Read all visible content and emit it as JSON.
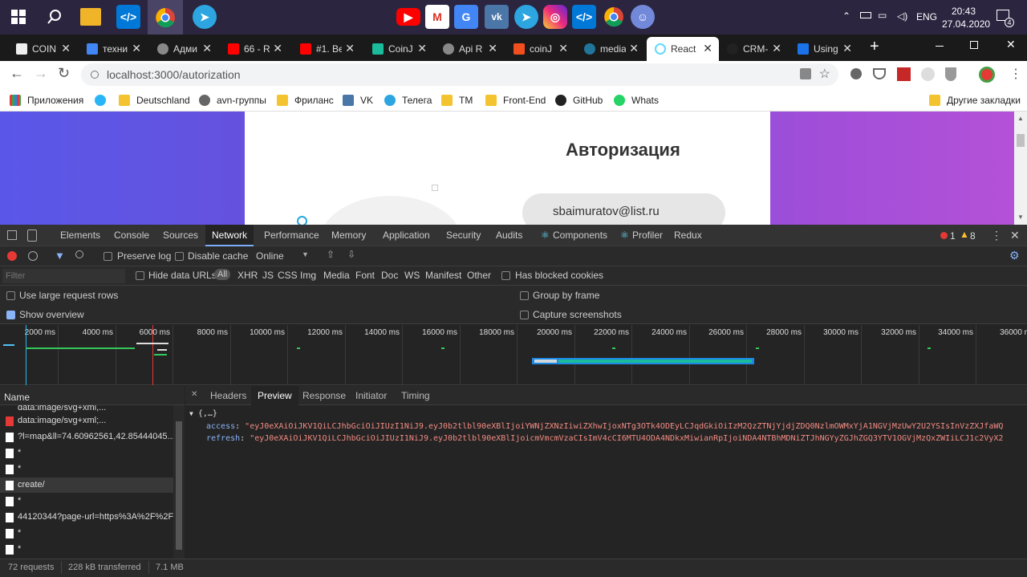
{
  "taskbar": {
    "time": "20:43",
    "date": "27.04.2020",
    "lang": "ENG",
    "notif_count": "4"
  },
  "tabs": [
    {
      "label": "COIN"
    },
    {
      "label": "техни"
    },
    {
      "label": "Адми"
    },
    {
      "label": "66 - R"
    },
    {
      "label": "#1. Be"
    },
    {
      "label": "CoinJ"
    },
    {
      "label": "Api R"
    },
    {
      "label": "coinJ"
    },
    {
      "label": "media"
    },
    {
      "label": "React"
    },
    {
      "label": "CRM-"
    },
    {
      "label": "Using"
    }
  ],
  "address": {
    "url": "localhost:3000/autorization"
  },
  "bookmarks": [
    {
      "label": "Приложения"
    },
    {
      "label": "Deutschland"
    },
    {
      "label": "avn-группы"
    },
    {
      "label": "Фриланс"
    },
    {
      "label": "VK"
    },
    {
      "label": "Телега"
    },
    {
      "label": "TM"
    },
    {
      "label": "Front-End"
    },
    {
      "label": "GitHub"
    },
    {
      "label": "Whats"
    }
  ],
  "other_bookmarks": "Другие закладки",
  "page": {
    "title": "Авторизация",
    "email": "sbaimuratov@list.ru"
  },
  "devtools": {
    "tabs": [
      "Elements",
      "Console",
      "Sources",
      "Network",
      "Performance",
      "Memory",
      "Application",
      "Security",
      "Audits",
      "Components",
      "Profiler",
      "Redux"
    ],
    "errors": "1",
    "warnings": "8",
    "toolbar": {
      "preserve_log": "Preserve log",
      "disable_cache": "Disable cache",
      "throttle": "Online"
    },
    "filter": {
      "placeholder": "Filter",
      "hide_data_urls": "Hide data URLs",
      "types": [
        "All",
        "XHR",
        "JS",
        "CSS",
        "Img",
        "Media",
        "Font",
        "Doc",
        "WS",
        "Manifest",
        "Other"
      ],
      "blocked": "Has blocked cookies"
    },
    "options": {
      "large_rows": "Use large request rows",
      "show_overview": "Show overview",
      "group_by_frame": "Group by frame",
      "capture_screenshots": "Capture screenshots"
    },
    "timeline_ticks": [
      "2000 ms",
      "4000 ms",
      "6000 ms",
      "8000 ms",
      "10000 ms",
      "12000 ms",
      "14000 ms",
      "16000 ms",
      "18000 ms",
      "20000 ms",
      "22000 ms",
      "24000 ms",
      "26000 ms",
      "28000 ms",
      "30000 ms",
      "32000 ms",
      "34000 ms",
      "36000 m"
    ],
    "name_header": "Name",
    "requests": [
      {
        "name": "data:image/svg+xml,..."
      },
      {
        "name": "data:image/svg+xml;..."
      },
      {
        "name": "?l=map&ll=74.60962561,42.85444045..."
      },
      {
        "name": "*"
      },
      {
        "name": "*"
      },
      {
        "name": "create/"
      },
      {
        "name": "*"
      },
      {
        "name": "44120344?page-url=https%3A%2F%2F"
      },
      {
        "name": "*"
      },
      {
        "name": "*"
      }
    ],
    "detail_tabs": [
      "Headers",
      "Preview",
      "Response",
      "Initiator",
      "Timing"
    ],
    "preview": {
      "summary": "{,…}",
      "access_key": "access",
      "access_val": "\"eyJ0eXAiOiJKV1QiLCJhbGciOiJIUzI1NiJ9.eyJ0b2tlbl90eXBlIjoiYWNjZXNzIiwiZXhwIjoxNTg3OTk4ODEyLCJqdGkiOiIzM2QzZTNjYjdjZDQ0NzlmOWMxYjA1NGVjMzUwY2U2YSIsInVzZXJfaWQ",
      "refresh_key": "refresh",
      "refresh_val": "\"eyJ0eXAiOiJKV1QiLCJhbGciOiJIUzI1NiJ9.eyJ0b2tlbl90eXBlIjoicmVmcmVzaCIsImV4cCI6MTU4ODA4NDkxMiwianRpIjoiNDA4NTBhMDNiZTJhNGYyZGJhZGQ3YTV1OGVjMzQxZWIiLCJ1c2VyX2"
    },
    "status": {
      "requests": "72 requests",
      "transferred": "228 kB transferred",
      "resources": "7.1 MB"
    }
  }
}
